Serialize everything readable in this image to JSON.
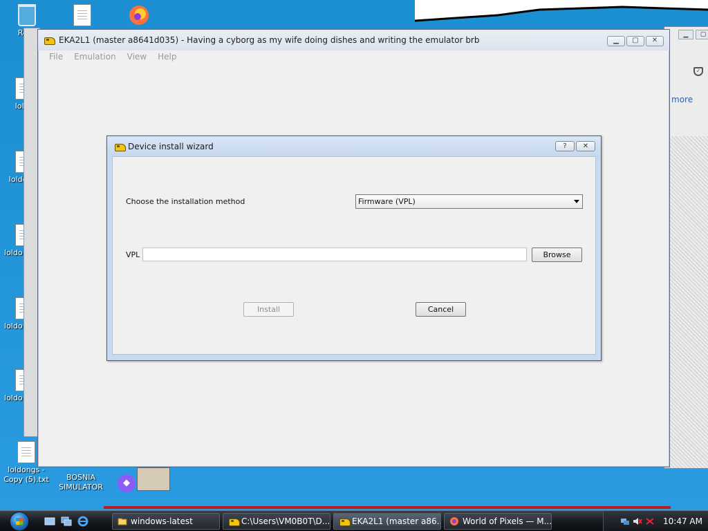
{
  "desktop": {
    "icons": [
      {
        "label": "Recy"
      },
      {
        "label": "loldo"
      },
      {
        "label": "loldo Co"
      },
      {
        "label": "loldo Copy"
      },
      {
        "label": "loldo Copy"
      },
      {
        "label": "loldo Copy"
      },
      {
        "label": "loldongs - Copy (5).txt"
      },
      {
        "label": "BOSNIA SIMULATOR"
      }
    ]
  },
  "background_window": {
    "more_link": "more"
  },
  "app_window": {
    "title": "EKA2L1 (master a8641d035) - Having a cyborg as my wife doing dishes and writing the emulator brb",
    "menu": [
      "File",
      "Emulation",
      "View",
      "Help"
    ]
  },
  "dialog": {
    "title": "Device install wizard",
    "help_label": "?",
    "close_label": "✕",
    "method_label": "Choose the installation method",
    "method_value": "Firmware (VPL)",
    "vpl_label": "VPL",
    "vpl_value": "",
    "browse_label": "Browse",
    "install_label": "Install",
    "cancel_label": "Cancel"
  },
  "taskbar": {
    "tasks": [
      {
        "label": "windows-latest"
      },
      {
        "label": "C:\\Users\\VM0B0T\\D..."
      },
      {
        "label": "EKA2L1 (master a86..."
      },
      {
        "label": "World of Pixels — M..."
      }
    ],
    "clock": "10:47 AM"
  },
  "colors": {
    "desktop": "#1a8fd0",
    "dialog_frame": "#c9daf0",
    "window_bg": "#f0f0f0",
    "taskbar": "#15181d",
    "accent_purple": "#8b5cf6"
  }
}
